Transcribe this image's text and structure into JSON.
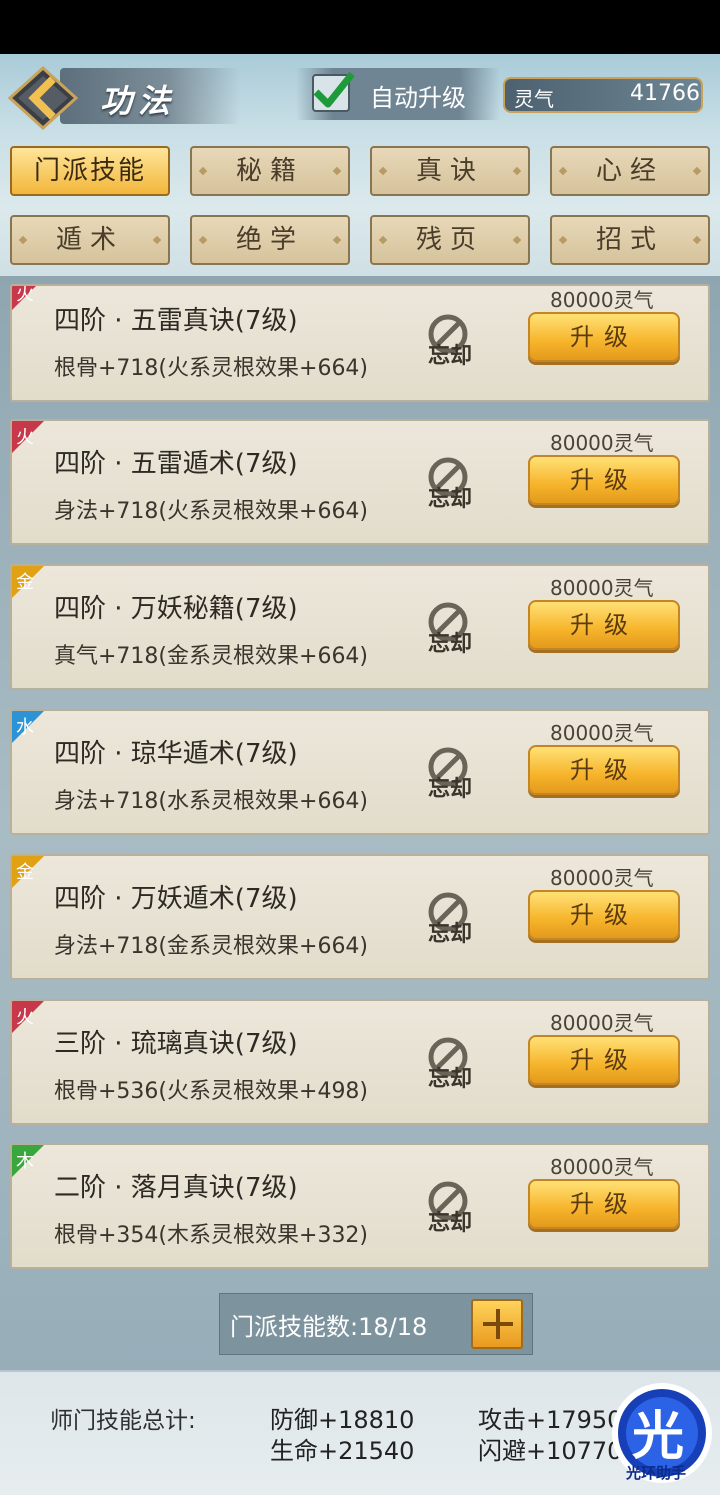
{
  "header": {
    "title": "功法",
    "auto_upgrade_label": "自动升级",
    "auto_upgrade_checked": true,
    "lingqi_label": "灵气",
    "lingqi_value": "41766"
  },
  "tabs": [
    {
      "label": "门派技能",
      "active": true
    },
    {
      "label": "秘籍",
      "active": false
    },
    {
      "label": "真诀",
      "active": false
    },
    {
      "label": "心经",
      "active": false
    },
    {
      "label": "遁术",
      "active": false
    },
    {
      "label": "绝学",
      "active": false
    },
    {
      "label": "残页",
      "active": false
    },
    {
      "label": "招式",
      "active": false
    }
  ],
  "skills": [
    {
      "element": "火",
      "element_color": "#c7394a",
      "name": "四阶 · 五雷真诀(7级)",
      "effect": "根骨+718(火系灵根效果+664)",
      "forget_label": "忘却",
      "cost": "80000灵气",
      "upgrade_label": "升级"
    },
    {
      "element": "火",
      "element_color": "#c7394a",
      "name": "四阶 · 五雷遁术(7级)",
      "effect": "身法+718(火系灵根效果+664)",
      "forget_label": "忘却",
      "cost": "80000灵气",
      "upgrade_label": "升级"
    },
    {
      "element": "金",
      "element_color": "#e0a114",
      "name": "四阶 · 万妖秘籍(7级)",
      "effect": "真气+718(金系灵根效果+664)",
      "forget_label": "忘却",
      "cost": "80000灵气",
      "upgrade_label": "升级"
    },
    {
      "element": "水",
      "element_color": "#2b93d6",
      "name": "四阶 · 琼华遁术(7级)",
      "effect": "身法+718(水系灵根效果+664)",
      "forget_label": "忘却",
      "cost": "80000灵气",
      "upgrade_label": "升级"
    },
    {
      "element": "金",
      "element_color": "#e0a114",
      "name": "四阶 · 万妖遁术(7级)",
      "effect": "身法+718(金系灵根效果+664)",
      "forget_label": "忘却",
      "cost": "80000灵气",
      "upgrade_label": "升级"
    },
    {
      "element": "火",
      "element_color": "#c7394a",
      "name": "三阶 · 琉璃真诀(7级)",
      "effect": "根骨+536(火系灵根效果+498)",
      "forget_label": "忘却",
      "cost": "80000灵气",
      "upgrade_label": "升级"
    },
    {
      "element": "木",
      "element_color": "#3aa63e",
      "name": "二阶 · 落月真诀(7级)",
      "effect": "根骨+354(木系灵根效果+332)",
      "forget_label": "忘却",
      "cost": "80000灵气",
      "upgrade_label": "升级"
    }
  ],
  "skill_count": {
    "label": "门派技能数:18/18"
  },
  "totals": {
    "label": "师门技能总计:",
    "defense": "防御+18810",
    "life": "生命+21540",
    "attack": "攻击+17950",
    "dodge": "闪避+10770"
  },
  "watermark": {
    "glyph": "光",
    "text": "光环助手"
  }
}
